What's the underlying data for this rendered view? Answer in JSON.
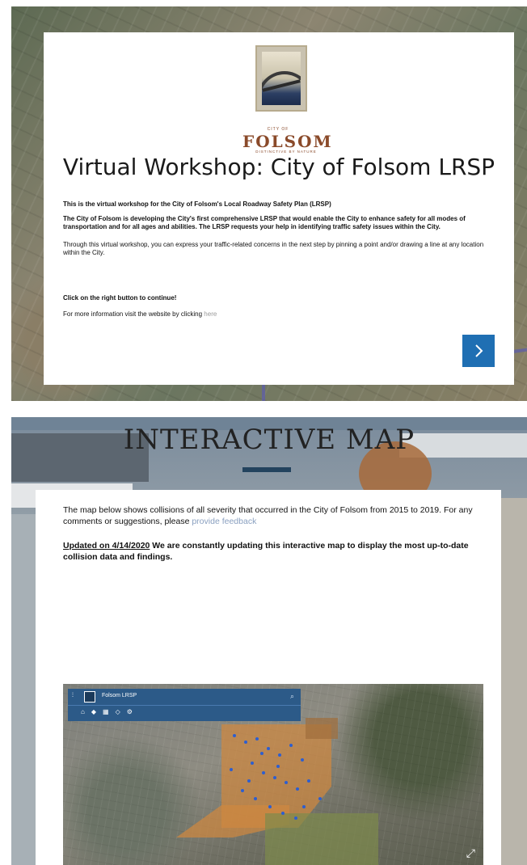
{
  "workshop": {
    "logo_text": {
      "city_of": "CITY OF",
      "folsom": "FOLSOM",
      "tagline": "DISTINCTIVE BY NATURE"
    },
    "title": "Virtual Workshop: City of Folsom LRSP",
    "paragraphs": [
      "This is the virtual workshop for the City of Folsom's Local Roadway Safety Plan (LRSP)",
      "The City of Folsom is developing the City's first comprehensive LRSP that would enable the City to enhance safety for all modes of transportation and for all ages and abilities. The LRSP requests your help in identifying traffic safety issues within the City.",
      "Through this virtual workshop, you can express your traffic-related concerns in the next step by pinning a point and/or drawing a line at any location within the City.",
      "Click on the right button to continue!"
    ],
    "more_info_prefix": "For more information visit the website by clicking ",
    "more_info_link": "here",
    "next_icon": "chevron-right-icon"
  },
  "interactive_map": {
    "heading": "INTERACTIVE MAP",
    "desc_part1": "The map below shows collisions of all severity that occurred in the City of Folsom from 2015 to 2019. For any comments or suggestions, please ",
    "feedback_link": "provide feedback",
    "updated_label": "Updated on 4/14/2020",
    "updated_rest": " We are constantly updating this interactive map to display the most up-to-date collision data and findings.",
    "map_app": {
      "title": "Folsom LRSP",
      "icons": [
        "home-icon",
        "layers-icon",
        "grid-icon",
        "locate-icon",
        "settings-icon"
      ],
      "search_icon": "search-icon",
      "expand_icon": "expand-icon"
    }
  },
  "colors": {
    "button_blue": "#1f6fb3",
    "folsom_brown": "#8a4a2a",
    "map_toolbar": "#2c5a88",
    "collision_dot": "#2d5ed0",
    "city_region": "#cf8840"
  }
}
